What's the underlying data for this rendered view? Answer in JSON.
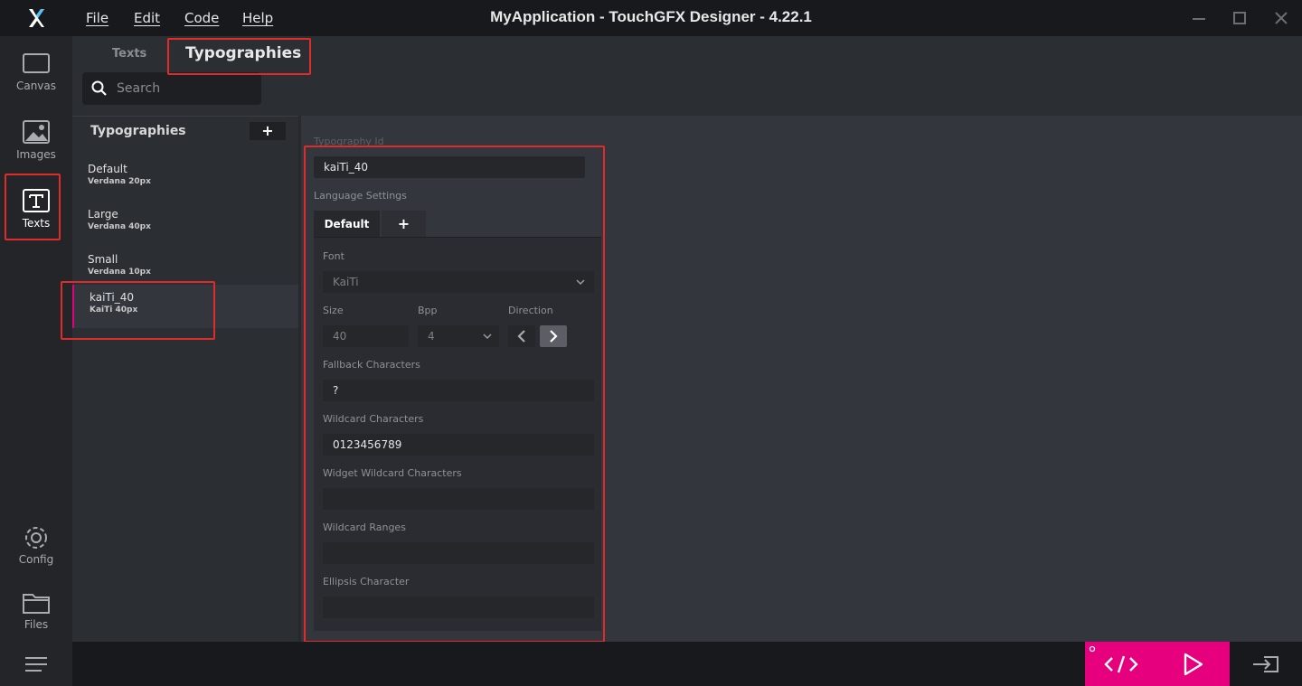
{
  "window": {
    "title": "MyApplication - TouchGFX Designer - 4.22.1"
  },
  "menu": [
    {
      "label": "File"
    },
    {
      "label": "Edit"
    },
    {
      "label": "Code"
    },
    {
      "label": "Help"
    }
  ],
  "rail": {
    "items": [
      {
        "label": "Canvas",
        "icon": "canvas-icon"
      },
      {
        "label": "Images",
        "icon": "image-icon"
      },
      {
        "label": "Texts",
        "icon": "text-icon",
        "active": true
      },
      {
        "label": "Config",
        "icon": "gear-icon"
      },
      {
        "label": "Files",
        "icon": "folder-icon"
      }
    ]
  },
  "top_tabs": [
    {
      "label": "Texts",
      "active": false
    },
    {
      "label": "Typographies",
      "active": true
    }
  ],
  "search": {
    "placeholder": "Search"
  },
  "typographies": {
    "header": "Typographies",
    "add_label": "+",
    "items": [
      {
        "name": "Default",
        "detail": "Verdana 20px"
      },
      {
        "name": "Large",
        "detail": "Verdana 40px"
      },
      {
        "name": "Small",
        "detail": "Verdana 10px"
      },
      {
        "name": "kaiTi_40",
        "detail": "KaiTi 40px",
        "selected": true
      }
    ]
  },
  "properties": {
    "typography_id_label": "Typography Id",
    "typography_id_value": "kaiTi_40",
    "language_settings_label": "Language Settings",
    "language_tabs": [
      {
        "label": "Default"
      },
      {
        "label": "+"
      }
    ],
    "font_label": "Font",
    "font_value": "KaiTi",
    "size_label": "Size",
    "size_value": "40",
    "bpp_label": "Bpp",
    "bpp_value": "4",
    "direction_label": "Direction",
    "fallback_label": "Fallback Characters",
    "fallback_value": "?",
    "wildcard_label": "Wildcard Characters",
    "wildcard_value": "0123456789",
    "widget_wildcard_label": "Widget Wildcard Characters",
    "widget_wildcard_value": "",
    "wildcard_ranges_label": "Wildcard Ranges",
    "wildcard_ranges_value": "",
    "ellipsis_label": "Ellipsis Character",
    "ellipsis_value": ""
  },
  "colors": {
    "accent": "#e6007e",
    "highlight": "#e02b2b",
    "titlebar": "#18191c",
    "panel": "#33363c"
  }
}
